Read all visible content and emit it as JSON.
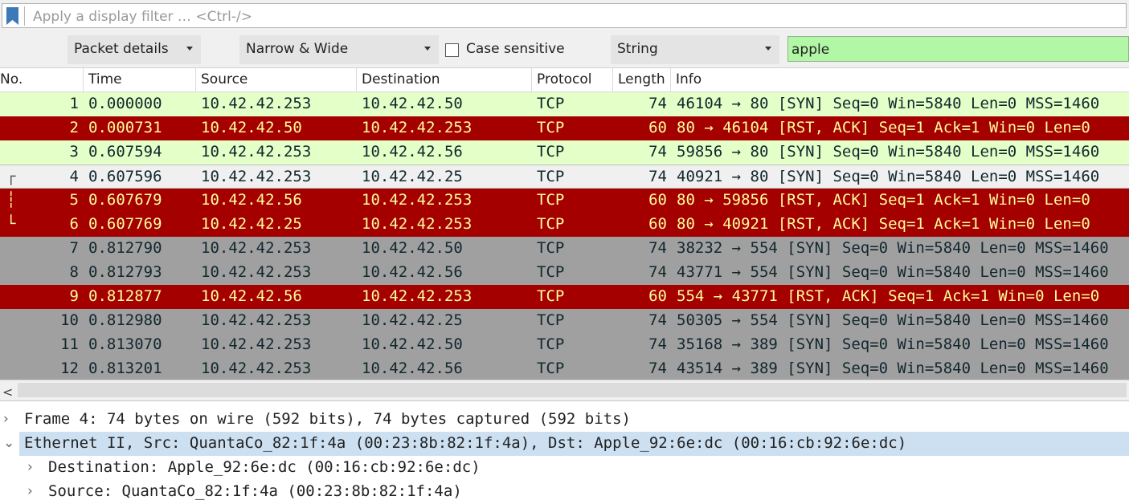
{
  "filter": {
    "placeholder": "Apply a display filter … <Ctrl-/>"
  },
  "find": {
    "search_in": "Packet details",
    "char_width": "Narrow & Wide",
    "case_label": "Case sensitive",
    "search_type": "String",
    "search_value": "apple",
    "search_bg": "#b2f7a6"
  },
  "columns": [
    "No.",
    "Time",
    "Source",
    "Destination",
    "Protocol",
    "Length",
    "Info"
  ],
  "colors": {
    "green": "#e4ffc7",
    "red": "#a40000",
    "gray": "#a0a0a0",
    "selected": "#f0f0f0"
  },
  "packets": [
    {
      "no": "1",
      "time": "0.000000",
      "src": "10.42.42.253",
      "dst": "10.42.42.50",
      "proto": "TCP",
      "len": "74",
      "info": "46104 → 80 [SYN] Seq=0 Win=5840 Len=0 MSS=1460",
      "style": "green"
    },
    {
      "no": "2",
      "time": "0.000731",
      "src": "10.42.42.50",
      "dst": "10.42.42.253",
      "proto": "TCP",
      "len": "60",
      "info": "80 → 46104 [RST, ACK] Seq=1 Ack=1 Win=0 Len=0",
      "style": "red"
    },
    {
      "no": "3",
      "time": "0.607594",
      "src": "10.42.42.253",
      "dst": "10.42.42.56",
      "proto": "TCP",
      "len": "74",
      "info": "59856 → 80 [SYN] Seq=0 Win=5840 Len=0 MSS=1460",
      "style": "green"
    },
    {
      "no": "4",
      "time": "0.607596",
      "src": "10.42.42.253",
      "dst": "10.42.42.25",
      "proto": "TCP",
      "len": "74",
      "info": "40921 → 80 [SYN] Seq=0 Win=5840 Len=0 MSS=1460",
      "style": "selected",
      "rel": "┌"
    },
    {
      "no": "5",
      "time": "0.607679",
      "src": "10.42.42.56",
      "dst": "10.42.42.253",
      "proto": "TCP",
      "len": "60",
      "info": "80 → 59856 [RST, ACK] Seq=1 Ack=1 Win=0 Len=0",
      "style": "red",
      "rel": "┆"
    },
    {
      "no": "6",
      "time": "0.607769",
      "src": "10.42.42.25",
      "dst": "10.42.42.253",
      "proto": "TCP",
      "len": "60",
      "info": "80 → 40921 [RST, ACK] Seq=1 Ack=1 Win=0 Len=0",
      "style": "red",
      "rel": "└"
    },
    {
      "no": "7",
      "time": "0.812790",
      "src": "10.42.42.253",
      "dst": "10.42.42.50",
      "proto": "TCP",
      "len": "74",
      "info": "38232 → 554 [SYN] Seq=0 Win=5840 Len=0 MSS=1460",
      "style": "gray"
    },
    {
      "no": "8",
      "time": "0.812793",
      "src": "10.42.42.253",
      "dst": "10.42.42.56",
      "proto": "TCP",
      "len": "74",
      "info": "43771 → 554 [SYN] Seq=0 Win=5840 Len=0 MSS=1460",
      "style": "gray"
    },
    {
      "no": "9",
      "time": "0.812877",
      "src": "10.42.42.56",
      "dst": "10.42.42.253",
      "proto": "TCP",
      "len": "60",
      "info": "554 → 43771 [RST, ACK] Seq=1 Ack=1 Win=0 Len=0",
      "style": "red"
    },
    {
      "no": "10",
      "time": "0.812980",
      "src": "10.42.42.253",
      "dst": "10.42.42.25",
      "proto": "TCP",
      "len": "74",
      "info": "50305 → 554 [SYN] Seq=0 Win=5840 Len=0 MSS=1460",
      "style": "gray"
    },
    {
      "no": "11",
      "time": "0.813070",
      "src": "10.42.42.253",
      "dst": "10.42.42.50",
      "proto": "TCP",
      "len": "74",
      "info": "35168 → 389 [SYN] Seq=0 Win=5840 Len=0 MSS=1460",
      "style": "gray"
    },
    {
      "no": "12",
      "time": "0.813201",
      "src": "10.42.42.253",
      "dst": "10.42.42.56",
      "proto": "TCP",
      "len": "74",
      "info": "43514 → 389 [SYN] Seq=0 Win=5840 Len=0 MSS=1460",
      "style": "gray"
    }
  ],
  "details": [
    {
      "text": "Frame 4: 74 bytes on wire (592 bits), 74 bytes captured (592 bits)",
      "expander": "›",
      "level": 0,
      "highlight": false
    },
    {
      "text": "Ethernet II, Src: QuantaCo_82:1f:4a (00:23:8b:82:1f:4a), Dst: Apple_92:6e:dc (00:16:cb:92:6e:dc)",
      "expander": "⌄",
      "level": 0,
      "highlight": true
    },
    {
      "text": "Destination: Apple_92:6e:dc (00:16:cb:92:6e:dc)",
      "expander": "›",
      "level": 1,
      "highlight": false
    },
    {
      "text": "Source: QuantaCo_82:1f:4a (00:23:8b:82:1f:4a)",
      "expander": "›",
      "level": 1,
      "highlight": false
    }
  ]
}
